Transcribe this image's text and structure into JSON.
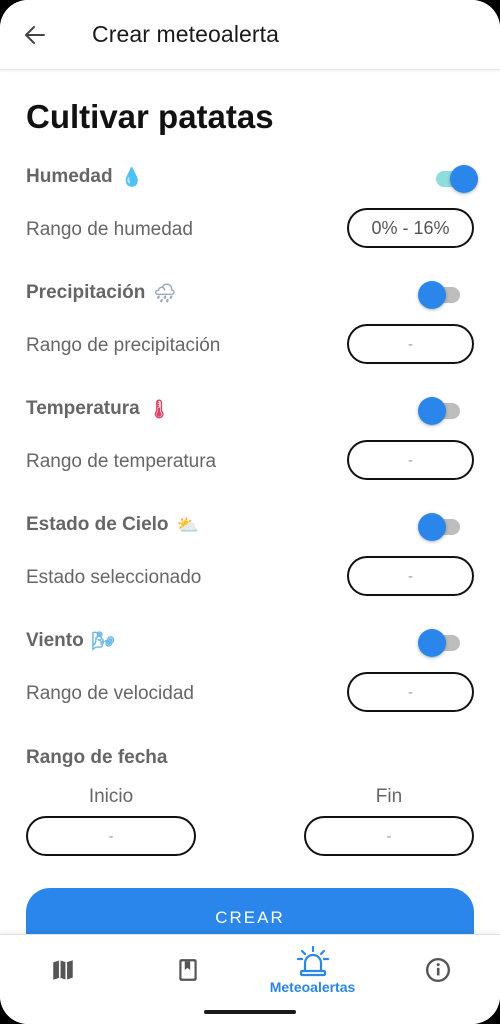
{
  "appbar": {
    "title": "Crear meteoalerta",
    "back_icon": "arrow-left-icon"
  },
  "page": {
    "title": "Cultivar patatas"
  },
  "sections": [
    {
      "key": "humedad",
      "header": "Humedad",
      "emoji": "💧",
      "enabled": true,
      "range_label": "Rango de humedad",
      "value": "0% - 16%"
    },
    {
      "key": "precipitacion",
      "header": "Precipitación",
      "emoji": "🌧",
      "enabled": false,
      "range_label": "Rango de precipitación",
      "value": "-"
    },
    {
      "key": "temperatura",
      "header": "Temperatura",
      "emoji": "🌡",
      "enabled": false,
      "range_label": "Rango de temperatura",
      "value": "-"
    },
    {
      "key": "cielo",
      "header": "Estado de Cielo",
      "emoji": "⛅",
      "enabled": false,
      "range_label": "Estado seleccionado",
      "value": "-"
    },
    {
      "key": "viento",
      "header": "Viento",
      "emoji": "🌬",
      "enabled": false,
      "range_label": "Rango de velocidad",
      "value": "-"
    }
  ],
  "date_range": {
    "title": "Rango de fecha",
    "start_label": "Inicio",
    "start_value": "-",
    "end_label": "Fin",
    "end_value": "-"
  },
  "create_button": {
    "label": "CREAR"
  },
  "bottom_nav": {
    "items": [
      {
        "icon": "map-icon",
        "label": "",
        "active": false
      },
      {
        "icon": "bookmark-book-icon",
        "label": "",
        "active": false
      },
      {
        "icon": "siren-alert-icon",
        "label": "Meteoalertas",
        "active": true
      },
      {
        "icon": "info-icon",
        "label": "",
        "active": false
      }
    ]
  },
  "colors": {
    "accent": "#2a86ea",
    "toggle_track_on": "#8fdcdc",
    "toggle_track_off": "#bdbdbd",
    "label_gray": "#666666"
  }
}
